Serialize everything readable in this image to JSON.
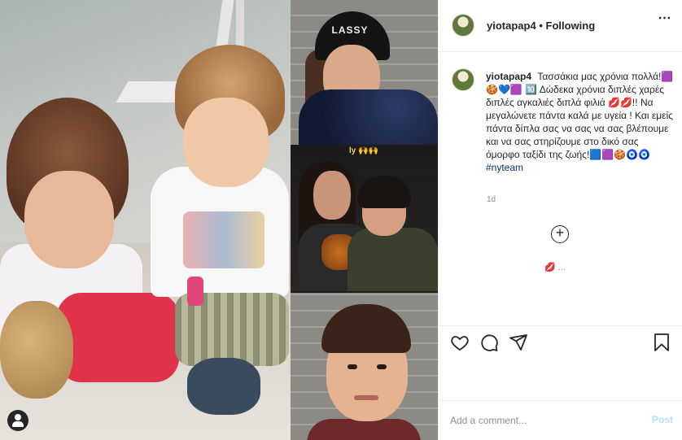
{
  "header": {
    "username": "yiotapap4",
    "separator": "•",
    "follow_status": "Following",
    "more_icon": "⋯"
  },
  "photo": {
    "hat_text": "LASSY",
    "tile2_label": "ly 🙌🙌"
  },
  "caption": {
    "username": "yiotapap4",
    "text": "Τασσάκια μας χρόνια πολλά!🟪🍪💙🟪 🔟 Δώδεκα χρόνια διπλές χαρές διπλές αγκαλιές διπλά φιλιά 💋💋!! Να μεγαλώνετε πάντα καλά με υγεία ! Και εμείς πάντα δίπλα σας να σας να σας βλέπουμε και να σας στηρίζουμε στο δικό σας όμορφο ταξίδι της ζωής!🟦🟪🍪🧿🧿",
    "hashtag": "#nyteam",
    "time": "1d",
    "load_more_symbol": "+",
    "cut_row": "💋 ..."
  },
  "actions": {
    "like_icon": "heart-icon",
    "comment_icon": "comment-icon",
    "share_icon": "paper-plane-icon",
    "save_icon": "bookmark-icon"
  },
  "comment_box": {
    "placeholder": "Add a comment...",
    "post_label": "Post"
  },
  "colors": {
    "link": "#00376b",
    "post_disabled": "#b2dffc",
    "muted": "#8e8e8e"
  }
}
